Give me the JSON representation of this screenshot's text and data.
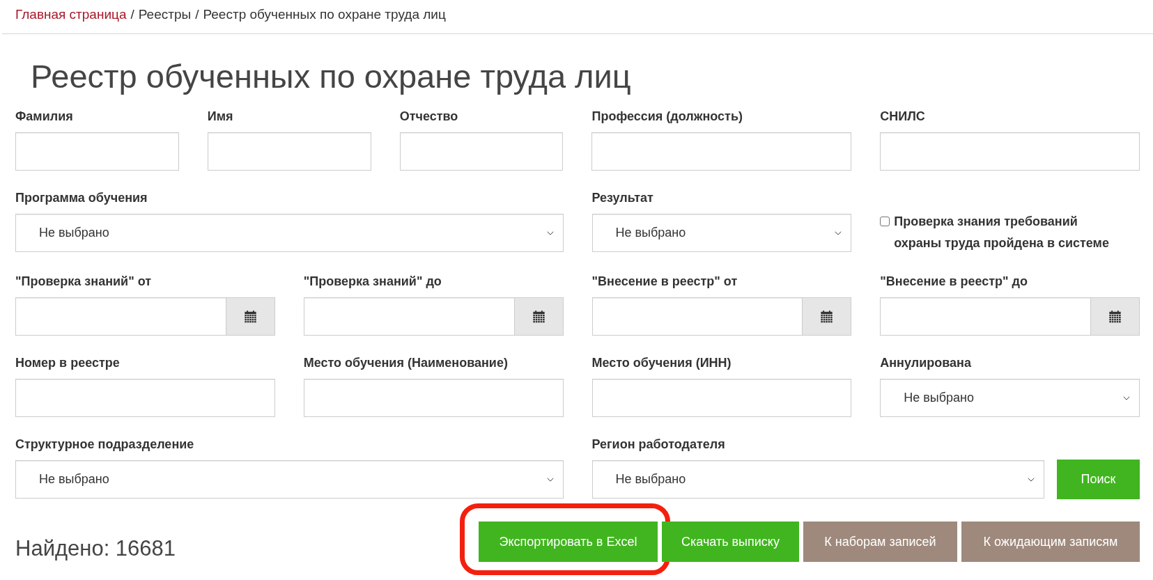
{
  "breadcrumb": [
    {
      "kind": "link",
      "label": "Главная страница"
    },
    {
      "kind": "separator",
      "label": "/"
    },
    {
      "kind": "text",
      "label": "Реестры"
    },
    {
      "kind": "separator",
      "label": "/"
    },
    {
      "kind": "text",
      "label": "Реестр обученных по охране труда лиц"
    }
  ],
  "title": "Реестр обученных по охране труда лиц",
  "filters": [
    [
      {
        "kind": "text",
        "label": "Фамилия"
      },
      {
        "kind": "text",
        "label": "Имя"
      },
      {
        "kind": "text",
        "label": "Отчество"
      },
      {
        "kind": "text",
        "label": "Профессия (должность)"
      },
      {
        "kind": "text",
        "label": "СНИЛС"
      }
    ],
    [
      {
        "kind": "select",
        "label": "Программа обучения",
        "value": "Не выбрано"
      },
      {
        "kind": "select",
        "label": "Результат",
        "value": "Не выбрано"
      },
      {
        "kind": "checkbox",
        "label": "Проверка знания требований охраны труда пройдена в системе",
        "checked": false
      }
    ],
    [
      {
        "kind": "date",
        "label": "\"Проверка знаний\" от"
      },
      {
        "kind": "date",
        "label": "\"Проверка знаний\" до"
      },
      {
        "kind": "date",
        "label": "\"Внесение в реестр\" от"
      },
      {
        "kind": "date",
        "label": "\"Внесение в реестр\" до"
      }
    ],
    [
      {
        "kind": "text",
        "label": "Номер в реестре"
      },
      {
        "kind": "text",
        "label": "Место обучения (Наименование)"
      },
      {
        "kind": "text",
        "label": "Место обучения (ИНН)"
      },
      {
        "kind": "select",
        "label": "Аннулирована",
        "value": "Не выбрано"
      }
    ],
    [
      {
        "kind": "select",
        "label": "Структурное подразделение",
        "value": "Не выбрано"
      },
      {
        "kind": "select",
        "label": "Регион работодателя",
        "value": "Не выбрано",
        "button": "Поиск"
      }
    ]
  ],
  "result_count": "Найдено: 16681",
  "actions": [
    {
      "kind": "primary",
      "label": "Экспортировать в Excel",
      "highlighted": true
    },
    {
      "kind": "primary",
      "label": "Скачать выписку",
      "highlighted": false
    },
    {
      "kind": "secondary",
      "label": "К наборам записей",
      "highlighted": false
    },
    {
      "kind": "secondary",
      "label": "К ожидающим записям",
      "highlighted": false
    }
  ]
}
